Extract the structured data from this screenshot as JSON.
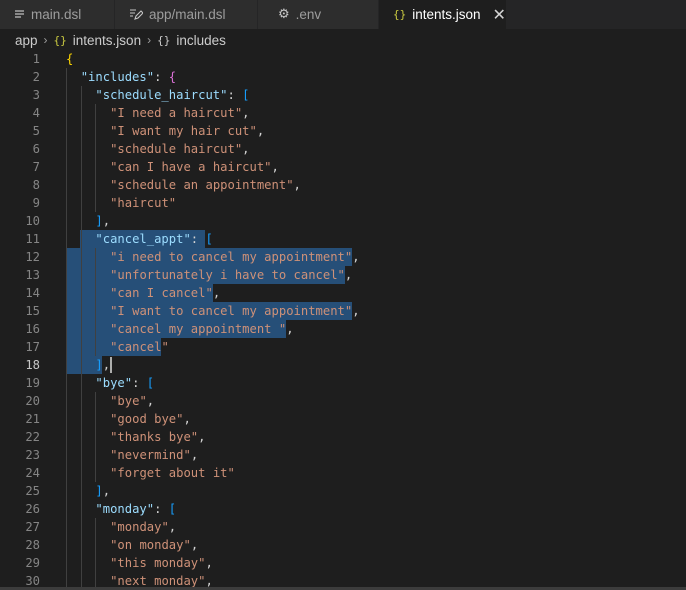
{
  "tabs": [
    {
      "label": "main.dsl",
      "icon": "lines-icon"
    },
    {
      "label": "app/main.dsl",
      "icon": "file-edit-icon"
    },
    {
      "label": ".env",
      "icon": "gear-icon"
    },
    {
      "label": "intents.json",
      "icon": "json-braces-icon",
      "active": true
    }
  ],
  "breadcrumb": {
    "folder": "app",
    "file": "intents.json",
    "symbol": "includes"
  },
  "editor": {
    "lines": [
      {
        "n": "1",
        "indent": 0,
        "tokens": [
          [
            "b",
            "{"
          ]
        ]
      },
      {
        "n": "2",
        "indent": 1,
        "tokens": [
          [
            "k",
            "\"includes\""
          ],
          [
            "p",
            ": "
          ],
          [
            "b2",
            "{"
          ]
        ]
      },
      {
        "n": "3",
        "indent": 2,
        "tokens": [
          [
            "k",
            "\"schedule_haircut\""
          ],
          [
            "p",
            ": "
          ],
          [
            "b3",
            "["
          ]
        ]
      },
      {
        "n": "4",
        "indent": 3,
        "tokens": [
          [
            "s",
            "\"I need a haircut\""
          ],
          [
            "p",
            ","
          ]
        ]
      },
      {
        "n": "5",
        "indent": 3,
        "tokens": [
          [
            "s",
            "\"I want my hair cut\""
          ],
          [
            "p",
            ","
          ]
        ]
      },
      {
        "n": "6",
        "indent": 3,
        "tokens": [
          [
            "s",
            "\"schedule haircut\""
          ],
          [
            "p",
            ","
          ]
        ]
      },
      {
        "n": "7",
        "indent": 3,
        "tokens": [
          [
            "s",
            "\"can I have a haircut\""
          ],
          [
            "p",
            ","
          ]
        ]
      },
      {
        "n": "8",
        "indent": 3,
        "tokens": [
          [
            "s",
            "\"schedule an appointment\""
          ],
          [
            "p",
            ","
          ]
        ]
      },
      {
        "n": "9",
        "indent": 3,
        "tokens": [
          [
            "s",
            "\"haircut\""
          ]
        ]
      },
      {
        "n": "10",
        "indent": 2,
        "tokens": [
          [
            "b3",
            "]"
          ],
          [
            "p",
            ","
          ]
        ]
      },
      {
        "n": "11",
        "indent": 2,
        "tokens": [
          [
            "k",
            "\"cancel_appt\""
          ],
          [
            "p",
            ": "
          ],
          [
            "b3",
            "["
          ]
        ]
      },
      {
        "n": "12",
        "indent": 3,
        "tokens": [
          [
            "s",
            "\"i need to cancel my appointment\""
          ],
          [
            "p",
            ","
          ]
        ]
      },
      {
        "n": "13",
        "indent": 3,
        "tokens": [
          [
            "s",
            "\"unfortunately i have to cancel\""
          ],
          [
            "p",
            ","
          ]
        ]
      },
      {
        "n": "14",
        "indent": 3,
        "tokens": [
          [
            "s",
            "\"can I cancel\""
          ],
          [
            "p",
            ","
          ]
        ]
      },
      {
        "n": "15",
        "indent": 3,
        "tokens": [
          [
            "s",
            "\"I want to cancel my appointment\""
          ],
          [
            "p",
            ","
          ]
        ]
      },
      {
        "n": "16",
        "indent": 3,
        "tokens": [
          [
            "s",
            "\"cancel my appointment \""
          ],
          [
            "p",
            ","
          ]
        ]
      },
      {
        "n": "17",
        "indent": 3,
        "tokens": [
          [
            "s",
            "\"cancel\""
          ]
        ]
      },
      {
        "n": "18",
        "indent": 2,
        "tokens": [
          [
            "b3",
            "]"
          ],
          [
            "p",
            ","
          ]
        ]
      },
      {
        "n": "19",
        "indent": 2,
        "tokens": [
          [
            "k",
            "\"bye\""
          ],
          [
            "p",
            ": "
          ],
          [
            "b3",
            "["
          ]
        ]
      },
      {
        "n": "20",
        "indent": 3,
        "tokens": [
          [
            "s",
            "\"bye\""
          ],
          [
            "p",
            ","
          ]
        ]
      },
      {
        "n": "21",
        "indent": 3,
        "tokens": [
          [
            "s",
            "\"good bye\""
          ],
          [
            "p",
            ","
          ]
        ]
      },
      {
        "n": "22",
        "indent": 3,
        "tokens": [
          [
            "s",
            "\"thanks bye\""
          ],
          [
            "p",
            ","
          ]
        ]
      },
      {
        "n": "23",
        "indent": 3,
        "tokens": [
          [
            "s",
            "\"nevermind\""
          ],
          [
            "p",
            ","
          ]
        ]
      },
      {
        "n": "24",
        "indent": 3,
        "tokens": [
          [
            "s",
            "\"forget about it\""
          ]
        ]
      },
      {
        "n": "25",
        "indent": 2,
        "tokens": [
          [
            "b3",
            "]"
          ],
          [
            "p",
            ","
          ]
        ]
      },
      {
        "n": "26",
        "indent": 2,
        "tokens": [
          [
            "k",
            "\"monday\""
          ],
          [
            "p",
            ": "
          ],
          [
            "b3",
            "["
          ]
        ]
      },
      {
        "n": "27",
        "indent": 3,
        "tokens": [
          [
            "s",
            "\"monday\""
          ],
          [
            "p",
            ","
          ]
        ]
      },
      {
        "n": "28",
        "indent": 3,
        "tokens": [
          [
            "s",
            "\"on monday\""
          ],
          [
            "p",
            ","
          ]
        ]
      },
      {
        "n": "29",
        "indent": 3,
        "tokens": [
          [
            "s",
            "\"this monday\""
          ],
          [
            "p",
            ","
          ]
        ]
      },
      {
        "n": "30",
        "indent": 3,
        "tokens": [
          [
            "s",
            "\"next monday\""
          ],
          [
            "p",
            ","
          ]
        ]
      }
    ],
    "selection_lines": [
      "11",
      "12",
      "13",
      "14",
      "15",
      "16",
      "17",
      "18"
    ],
    "cursor_line": "18"
  },
  "colors": {
    "background": "#1e1e1e",
    "selection": "#264f78",
    "json_key": "#9cdcfe",
    "json_string": "#ce9178"
  }
}
